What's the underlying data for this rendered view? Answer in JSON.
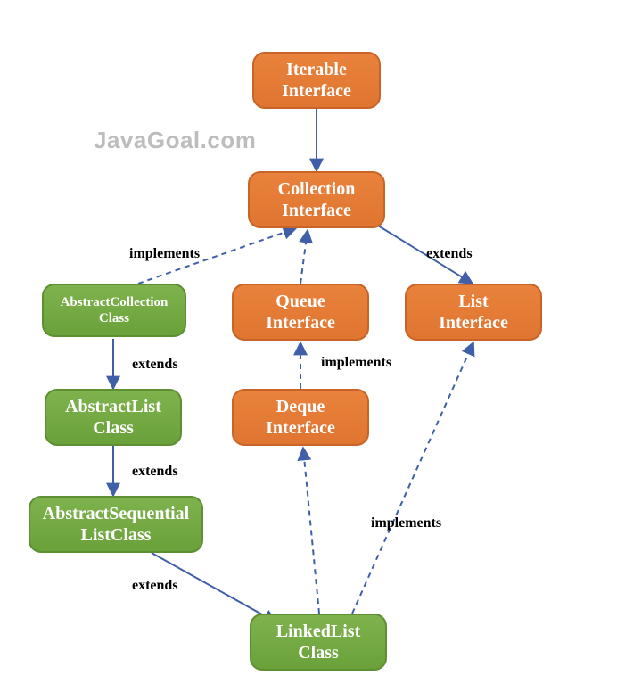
{
  "watermark": "JavaGoal.com",
  "nodes": {
    "iterable": {
      "line1": "Iterable",
      "line2": "Interface"
    },
    "collection": {
      "line1": "Collection",
      "line2": "Interface"
    },
    "abscoll": {
      "line1": "AbstractCollection",
      "line2": "Class"
    },
    "queue": {
      "line1": "Queue",
      "line2": "Interface"
    },
    "list": {
      "line1": "List",
      "line2": "Interface"
    },
    "abslist": {
      "line1": "AbstractList",
      "line2": "Class"
    },
    "deque": {
      "line1": "Deque",
      "line2": "Interface"
    },
    "absseq": {
      "line1": "AbstractSequential",
      "line2": "ListClass"
    },
    "linked": {
      "line1": "LinkedList",
      "line2": "Class"
    }
  },
  "labels": {
    "l1": "implements",
    "l2": "extends",
    "l3": "extends",
    "l4": "implements",
    "l5": "extends",
    "l6": "extends",
    "l7": "implements"
  },
  "chart_data": {
    "type": "graph",
    "nodes": [
      {
        "id": "Iterable Interface",
        "kind": "interface",
        "color": "orange"
      },
      {
        "id": "Collection Interface",
        "kind": "interface",
        "color": "orange"
      },
      {
        "id": "AbstractCollection Class",
        "kind": "class",
        "color": "green"
      },
      {
        "id": "Queue Interface",
        "kind": "interface",
        "color": "orange"
      },
      {
        "id": "List Interface",
        "kind": "interface",
        "color": "orange"
      },
      {
        "id": "AbstractList Class",
        "kind": "class",
        "color": "green"
      },
      {
        "id": "Deque Interface",
        "kind": "interface",
        "color": "orange"
      },
      {
        "id": "AbstractSequentialList Class",
        "kind": "class",
        "color": "green"
      },
      {
        "id": "LinkedList Class",
        "kind": "class",
        "color": "green"
      }
    ],
    "edges": [
      {
        "from": "Collection Interface",
        "to": "Iterable Interface",
        "relation": "extends",
        "style": "solid"
      },
      {
        "from": "AbstractCollection Class",
        "to": "Collection Interface",
        "relation": "implements",
        "style": "dashed"
      },
      {
        "from": "Queue Interface",
        "to": "Collection Interface",
        "relation": "extends",
        "style": "dashed"
      },
      {
        "from": "List Interface",
        "to": "Collection Interface",
        "relation": "extends",
        "style": "solid"
      },
      {
        "from": "AbstractList Class",
        "to": "AbstractCollection Class",
        "relation": "extends",
        "style": "solid"
      },
      {
        "from": "Deque Interface",
        "to": "Queue Interface",
        "relation": "implements",
        "style": "dashed"
      },
      {
        "from": "AbstractSequentialList Class",
        "to": "AbstractList Class",
        "relation": "extends",
        "style": "solid"
      },
      {
        "from": "LinkedList Class",
        "to": "AbstractSequentialList Class",
        "relation": "extends",
        "style": "solid"
      },
      {
        "from": "LinkedList Class",
        "to": "Deque Interface",
        "relation": "implements",
        "style": "dashed"
      },
      {
        "from": "LinkedList Class",
        "to": "List Interface",
        "relation": "implements",
        "style": "dashed"
      }
    ]
  }
}
